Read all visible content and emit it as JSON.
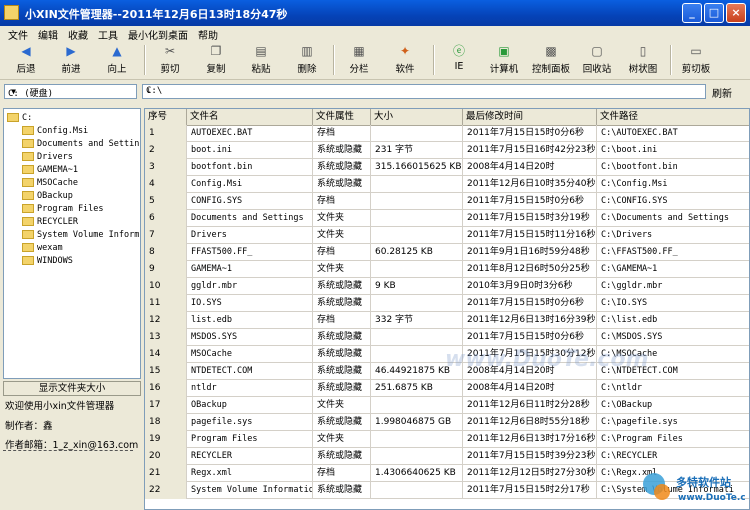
{
  "window": {
    "title": "小XIN文件管理器--2011年12月6日13时18分47秒"
  },
  "menu": [
    "文件",
    "编辑",
    "收藏",
    "工具",
    "最小化到桌面",
    "帮助"
  ],
  "toolbar": [
    {
      "label": "后退",
      "icon": "back-arrow-icon"
    },
    {
      "label": "前进",
      "icon": "forward-arrow-icon"
    },
    {
      "label": "向上",
      "icon": "up-arrow-icon"
    },
    {
      "label": "剪切",
      "icon": "cut-icon"
    },
    {
      "label": "复制",
      "icon": "copy-icon"
    },
    {
      "label": "粘贴",
      "icon": "paste-icon"
    },
    {
      "label": "删除",
      "icon": "delete-icon"
    },
    {
      "label": "分栏",
      "icon": "split-icon"
    },
    {
      "label": "软件",
      "icon": "software-icon"
    },
    {
      "label": "IE",
      "icon": "ie-icon"
    },
    {
      "label": "计算机",
      "icon": "computer-icon"
    },
    {
      "label": "控制面板",
      "icon": "control-panel-icon"
    },
    {
      "label": "回收站",
      "icon": "recycle-bin-icon"
    },
    {
      "label": "树状图",
      "icon": "tree-view-icon"
    },
    {
      "label": "剪切板",
      "icon": "clipboard-icon"
    }
  ],
  "drive_select": "C: (硬盘)",
  "path": "C:\\",
  "refresh_label": "刷新",
  "tree": {
    "root": "C:",
    "items": [
      "Config.Msi",
      "Documents and Settin",
      "Drivers",
      "GAMEMA~1",
      "MSOCache",
      "OBackup",
      "Program Files",
      "RECYCLER",
      "System Volume Inform",
      "wexam",
      "WINDOWS"
    ]
  },
  "show_folder_size": "显示文件夹大小",
  "info": {
    "welcome": "欢迎使用小xin文件管理器",
    "author": "制作者：鑫",
    "email": "作者邮箱：1_z_xin@163.com"
  },
  "table": {
    "headers": [
      "序号",
      "文件名",
      "文件属性",
      "大小",
      "最后修改时间",
      "文件路径"
    ],
    "rows": [
      [
        "1",
        "AUTOEXEC.BAT",
        "存档",
        "",
        "2011年7月15日15时0分6秒",
        "C:\\AUTOEXEC.BAT"
      ],
      [
        "2",
        "boot.ini",
        "系统或隐藏",
        "231 字节",
        "2011年7月15日16时42分23秒",
        "C:\\boot.ini"
      ],
      [
        "3",
        "bootfont.bin",
        "系统或隐藏",
        "315.166015625 KB",
        "2008年4月14日20时",
        "C:\\bootfont.bin"
      ],
      [
        "4",
        "Config.Msi",
        "系统或隐藏",
        "",
        "2011年12月6日10时35分40秒",
        "C:\\Config.Msi"
      ],
      [
        "5",
        "CONFIG.SYS",
        "存档",
        "",
        "2011年7月15日15时0分6秒",
        "C:\\CONFIG.SYS"
      ],
      [
        "6",
        "Documents and Settings",
        "文件夹",
        "",
        "2011年7月15日15时3分19秒",
        "C:\\Documents and Settings"
      ],
      [
        "7",
        "Drivers",
        "文件夹",
        "",
        "2011年7月15日15时11分16秒",
        "C:\\Drivers"
      ],
      [
        "8",
        "FFAST500.FF_",
        "存档",
        "60.28125 KB",
        "2011年9月1日16时59分48秒",
        "C:\\FFAST500.FF_"
      ],
      [
        "9",
        "GAMEMA~1",
        "文件夹",
        "",
        "2011年8月12日6时50分25秒",
        "C:\\GAMEMA~1"
      ],
      [
        "10",
        "ggldr.mbr",
        "系统或隐藏",
        "9 KB",
        "2010年3月9日0时3分6秒",
        "C:\\ggldr.mbr"
      ],
      [
        "11",
        "IO.SYS",
        "系统或隐藏",
        "",
        "2011年7月15日15时0分6秒",
        "C:\\IO.SYS"
      ],
      [
        "12",
        "list.edb",
        "存档",
        "332 字节",
        "2011年12月6日13时16分39秒",
        "C:\\list.edb"
      ],
      [
        "13",
        "MSDOS.SYS",
        "系统或隐藏",
        "",
        "2011年7月15日15时0分6秒",
        "C:\\MSDOS.SYS"
      ],
      [
        "14",
        "MSOCache",
        "系统或隐藏",
        "",
        "2011年7月15日15时30分12秒",
        "C:\\MSOCache"
      ],
      [
        "15",
        "NTDETECT.COM",
        "系统或隐藏",
        "46.44921875 KB",
        "2008年4月14日20时",
        "C:\\NTDETECT.COM"
      ],
      [
        "16",
        "ntldr",
        "系统或隐藏",
        "251.6875 KB",
        "2008年4月14日20时",
        "C:\\ntldr"
      ],
      [
        "17",
        "OBackup",
        "文件夹",
        "",
        "2011年12月6日11时2分28秒",
        "C:\\OBackup"
      ],
      [
        "18",
        "pagefile.sys",
        "系统或隐藏",
        "1.998046875 GB",
        "2011年12月6日8时55分18秒",
        "C:\\pagefile.sys"
      ],
      [
        "19",
        "Program Files",
        "文件夹",
        "",
        "2011年12月6日13时17分16秒",
        "C:\\Program Files"
      ],
      [
        "20",
        "RECYCLER",
        "系统或隐藏",
        "",
        "2011年7月15日15时39分23秒",
        "C:\\RECYCLER"
      ],
      [
        "21",
        "Regx.xml",
        "存档",
        "1.4306640625 KB",
        "2011年12月12日5时27分30秒",
        "C:\\Regx.xml"
      ],
      [
        "22",
        "System Volume Informatio",
        "系统或隐藏",
        "",
        "2011年7月15日15时2分17秒",
        "C:\\System Volume Informati"
      ]
    ]
  },
  "watermark": {
    "center": "www.DuoTe.com",
    "corner_brand": "多特软件站",
    "corner_url": "www.DuoTe.com"
  }
}
